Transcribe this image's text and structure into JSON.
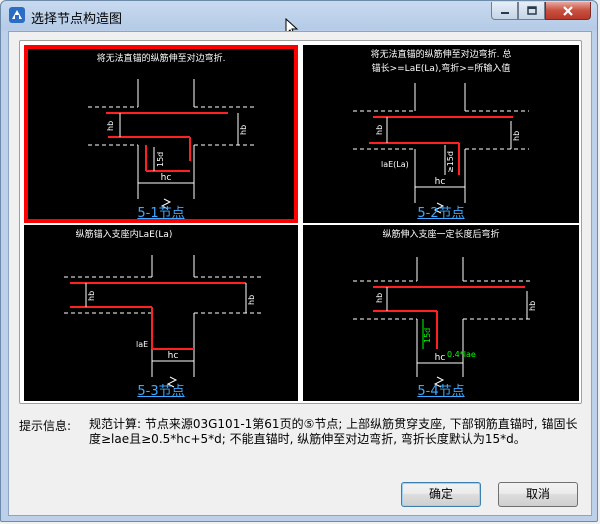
{
  "window": {
    "title": "选择节点构造图"
  },
  "panels": [
    {
      "caption": "5-1节点",
      "selected": true,
      "description": [
        "将无法直锚的纵筋伸至对边弯折."
      ],
      "labels": {
        "hb": "hb",
        "d15": "15d",
        "hc": "hc"
      }
    },
    {
      "caption": "5-2节点",
      "selected": false,
      "description": [
        "将无法直锚的纵筋伸至对边弯折. 总",
        "锚长>=LaE(La),弯折>=所输入值"
      ],
      "labels": {
        "hb": "hb",
        "d15": "≥15d",
        "lae": "laE(La)",
        "hc": "hc"
      }
    },
    {
      "caption": "5-3节点",
      "selected": false,
      "description": [
        "纵筋锚入支座内LaE(La)"
      ],
      "labels": {
        "hb": "hb",
        "lae": "laE",
        "hc": "hc"
      }
    },
    {
      "caption": "5-4节点",
      "selected": false,
      "description": [
        "纵筋伸入支座一定长度后弯折"
      ],
      "labels": {
        "hb": "hb",
        "d15": "15d",
        "lae04": "0.4*lae",
        "hc": "hc"
      }
    }
  ],
  "hint": {
    "label": "提示信息:",
    "text": "规范计算: 节点来源03G101-1第61页的⑤节点; 上部纵筋贯穿支座, 下部钢筋直锚时, 锚固长度≥lae且≥0.5*hc+5*d; 不能直锚时, 纵筋伸至对边弯折, 弯折长度默认为15*d。"
  },
  "buttons": {
    "ok": "确定",
    "cancel": "取消"
  },
  "icons": {
    "app": "app-icon",
    "minimize": "minimize-icon",
    "maximize": "maximize-icon",
    "close": "close-icon"
  },
  "colors": {
    "selected_border": "#ff0000",
    "rebar": "#ff2020",
    "drawing_bg": "#000000",
    "caption": "#3fa9ff",
    "dimension_green": "#00ff00"
  }
}
